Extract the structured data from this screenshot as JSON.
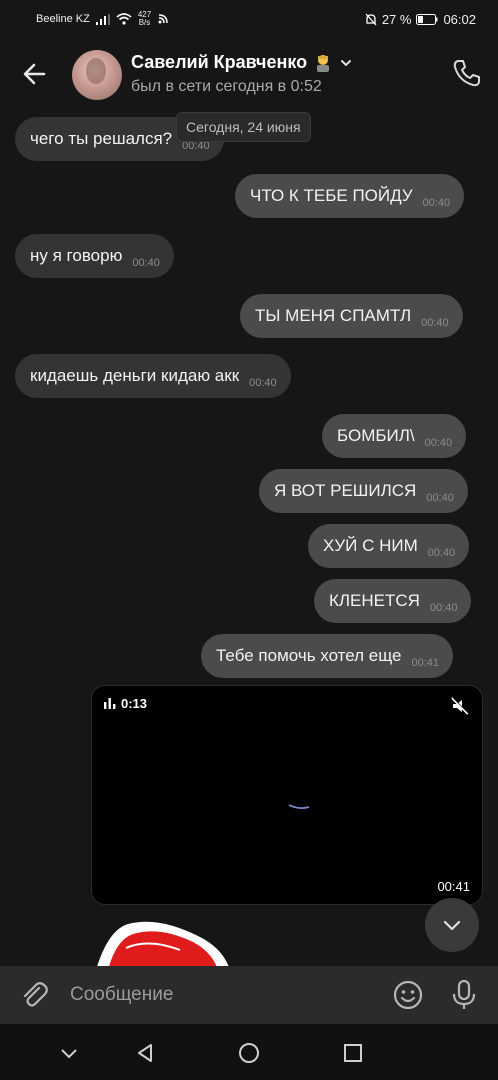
{
  "status_bar": {
    "carrier": "Beeline KZ",
    "net_speed_value": "427",
    "net_speed_unit": "B/s",
    "battery": "27 %",
    "time": "06:02"
  },
  "header": {
    "contact_name": "Савелий Кравченко",
    "last_seen": "был в сети сегодня в 0:52"
  },
  "chat": {
    "date_separator": "Сегодня, 24 июня",
    "messages": [
      {
        "direction": "in",
        "text": "чего ты решался?",
        "time": "00:40"
      },
      {
        "direction": "out",
        "text": "ЧТО К ТЕБЕ ПОЙДУ",
        "time": "00:40"
      },
      {
        "direction": "in",
        "text": "ну я говорю",
        "time": "00:40"
      },
      {
        "direction": "out",
        "text": "ТЫ МЕНЯ СПАМТЛ",
        "time": "00:40"
      },
      {
        "direction": "in",
        "text": "кидаешь деньги кидаю акк",
        "time": "00:40"
      },
      {
        "direction": "out",
        "text": "БОМБИЛ\\",
        "time": "00:40"
      },
      {
        "direction": "out",
        "text": "Я ВОТ РЕШИЛСЯ",
        "time": "00:40"
      },
      {
        "direction": "out",
        "text": "ХУЙ С НИМ",
        "time": "00:40"
      },
      {
        "direction": "out",
        "text": "КЛЕНЕТСЯ",
        "time": "00:40"
      },
      {
        "direction": "out",
        "text": "Тебе помочь хотел еще",
        "time": "00:41"
      }
    ],
    "video": {
      "duration": "0:13",
      "time": "00:41",
      "muted": true
    }
  },
  "composer": {
    "placeholder": "Сообщение"
  },
  "icons": {
    "back": "arrow-left-icon",
    "call": "phone-icon",
    "attach": "paperclip-icon",
    "emoji": "smile-icon",
    "voice": "microphone-icon"
  },
  "colors": {
    "background": "#161616",
    "incoming_bubble": "#343436",
    "outgoing_bubble": "#4b4b4d",
    "composer": "#2b2b2b"
  }
}
